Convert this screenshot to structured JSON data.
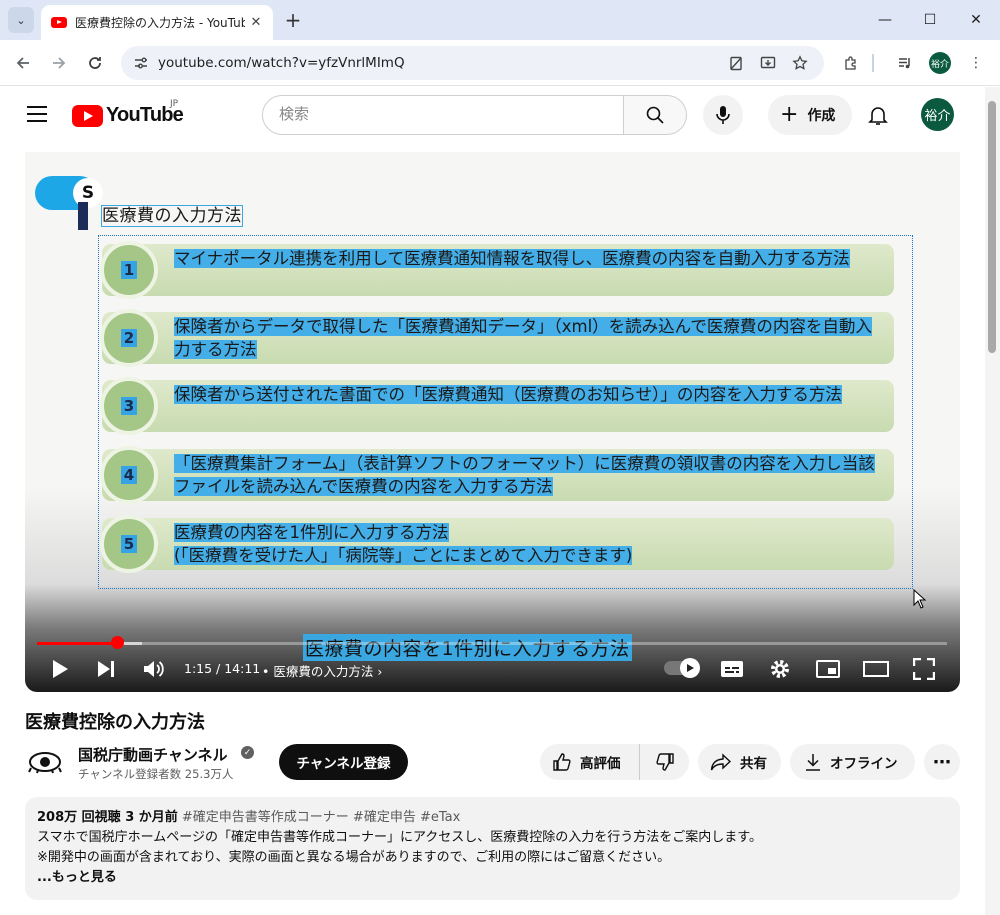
{
  "browser": {
    "tab_title": "医療費控除の入力方法 - YouTube",
    "tab_list_icon": "chevron-down-icon",
    "url": "youtube.com/watch?v=yfzVnrlMImQ",
    "profile_initials": "裕介",
    "new_tab": "+",
    "win_minimize": "—",
    "win_maximize": "☐",
    "win_close": "✕"
  },
  "header": {
    "logo_text": "YouTube",
    "region": "JP",
    "search_placeholder": "検索",
    "create_label": "作成",
    "avatar_initials": "裕介"
  },
  "slide": {
    "logo_letter": "S",
    "title": "医療費の入力方法",
    "items": [
      {
        "num": "1",
        "text": "マイナポータル連携を利用して医療費通知情報を取得し、医療費の内容を自動入力する方法"
      },
      {
        "num": "2",
        "text": "保険者からデータで取得した「医療費通知データ」（xml）を読み込んで医療費の内容を自動入力する方法"
      },
      {
        "num": "3",
        "text": "保険者から送付された書面での「医療費通知（医療費のお知らせ）」の内容を入力する方法"
      },
      {
        "num": "4",
        "text": "「医療費集計フォーム」（表計算ソフトのフォーマット）に医療費の領収書の内容を入力し当該ファイルを読み込んで医療費の内容を入力する方法"
      },
      {
        "num": "5",
        "text": "医療費の内容を1件別に入力する方法",
        "text2": "(「医療費を受けた人」「病院等」ごとにまとめて入力できます)"
      }
    ]
  },
  "player": {
    "caption": "医療費の内容を1件別に入力する方法",
    "time": "1:15 / 14:11",
    "chapter": "• 医療費の入力方法",
    "progress": 0.088
  },
  "video": {
    "title": "医療費控除の入力方法",
    "channel_name": "国税庁動画チャンネル",
    "subscribers": "チャンネル登録者数 25.3万人",
    "subscribe_label": "チャンネル登録",
    "like_label": "高評価",
    "share_label": "共有",
    "offline_label": "オフライン",
    "more_label": "⋯"
  },
  "description": {
    "views_date": "208万 回視聴  3 か月前",
    "hashtags": "#確定申告書等作成コーナー #確定申告 #eTax",
    "line1": "スマホで国税庁ホームページの「確定申告書等作成コーナー」にアクセスし、医療費控除の入力を行う方法をご案内します。",
    "line2": "※開発中の画面が含まれており、実際の画面と異なる場合がありますので、ご利用の際にはご留意ください。",
    "more": "...もっと見る"
  }
}
